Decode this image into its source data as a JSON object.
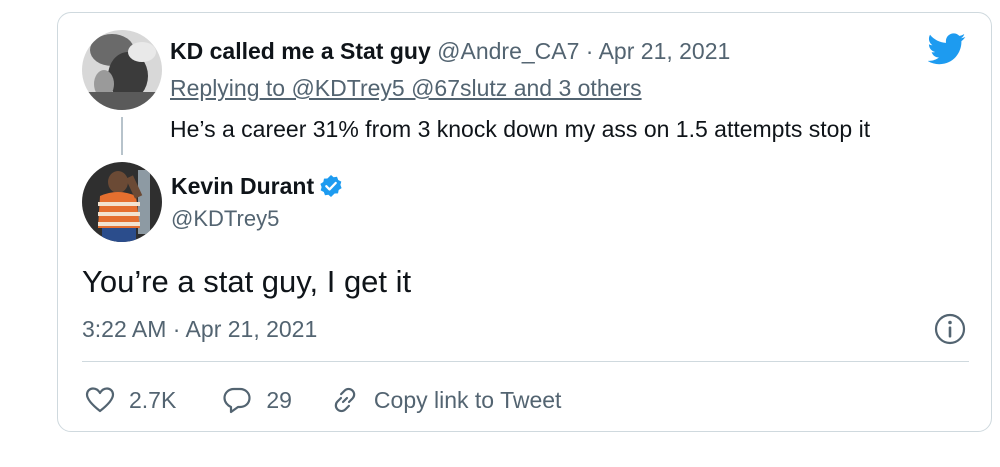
{
  "quoted_tweet": {
    "display_name": "KD called me a Stat guy",
    "handle": "@Andre_CA7",
    "separator": "·",
    "date": "Apr 21, 2021",
    "replying_to": "Replying to @KDTrey5 @67slutz and 3 others",
    "text": "He’s a career 31% from 3 knock down my ass on 1.5 attempts stop it"
  },
  "tweet": {
    "display_name": "Kevin Durant",
    "handle": "@KDTrey5",
    "text": "You’re a stat guy, I get it",
    "timestamp": "3:22 AM · Apr 21, 2021"
  },
  "actions": {
    "likes": "2.7K",
    "replies": "29",
    "copy_link": "Copy link to Tweet"
  },
  "icons": {
    "brand": "twitter-bird-icon",
    "verified": "verified-badge-icon",
    "info": "info-icon",
    "like": "heart-icon",
    "reply": "reply-bubble-icon",
    "link": "link-icon"
  },
  "colors": {
    "brand_blue": "#1d9bf0",
    "text": "#0f1419",
    "muted": "#536471",
    "border": "#cfd9de"
  }
}
